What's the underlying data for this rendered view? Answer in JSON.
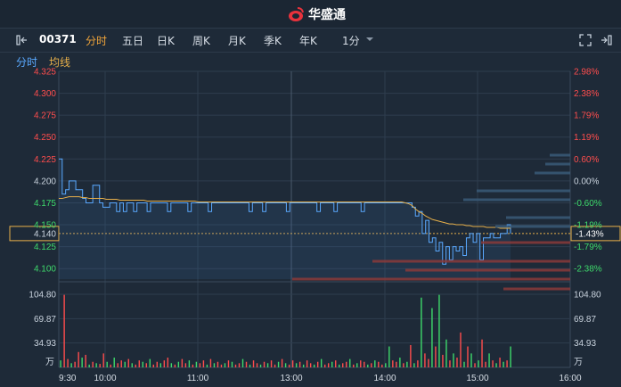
{
  "app": {
    "brand_name": "华盛通"
  },
  "toolbar": {
    "stock_code": "00371",
    "tabs": [
      {
        "label": "分时",
        "active": true
      },
      {
        "label": "五日",
        "active": false
      },
      {
        "label": "日K",
        "active": false
      },
      {
        "label": "周K",
        "active": false
      },
      {
        "label": "月K",
        "active": false
      },
      {
        "label": "季K",
        "active": false
      },
      {
        "label": "年K",
        "active": false
      }
    ],
    "interval": "1分",
    "icons": [
      "expand-left-icon",
      "dropdown-icon",
      "fullscreen-icon",
      "collapse-right-icon"
    ]
  },
  "legend": {
    "series_price": "分时",
    "series_avg": "均线"
  },
  "colors": {
    "price_line": "#5aa9ff",
    "avg_line": "#e8b04a",
    "up": "#ff4d4d",
    "down": "#3ed96b",
    "grid": "#2e3d4e",
    "current": "#e8b04a"
  },
  "chart_data": [
    {
      "type": "line",
      "y_left_ticks": [
        "4.325",
        "4.300",
        "4.275",
        "4.250",
        "4.225",
        "4.200",
        "4.175",
        "4.150",
        "4.125",
        "4.100"
      ],
      "y_right_ticks": [
        "2.98%",
        "2.38%",
        "1.79%",
        "1.19%",
        "0.60%",
        "0.00%",
        "-0.60%",
        "-1.19%",
        "-1.79%",
        "-2.38%"
      ],
      "ylim": [
        4.088,
        4.325
      ],
      "prev_close": 4.2,
      "current_price": "4.140",
      "current_change": "-1.43%",
      "x_ticks": [
        "9:30",
        "10:00",
        "11:00",
        "13:00",
        "14:00",
        "15:00",
        "16:00"
      ],
      "series": [
        {
          "name": "分时",
          "values": [
            4.225,
            4.185,
            4.19,
            4.2,
            4.2,
            4.19,
            4.19,
            4.18,
            4.175,
            4.175,
            4.195,
            4.195,
            4.175,
            4.17,
            4.17,
            4.175,
            4.175,
            4.165,
            4.175,
            4.165,
            4.175,
            4.175,
            4.165,
            4.175,
            4.175,
            4.175,
            4.165,
            4.175,
            4.175,
            4.175,
            4.175,
            4.175,
            4.165,
            4.175,
            4.175,
            4.175,
            4.175,
            4.175,
            4.165,
            4.175,
            4.175,
            4.175,
            4.175,
            4.175,
            4.165,
            4.175,
            4.175,
            4.175,
            4.175,
            4.175,
            4.175,
            4.175,
            4.175,
            4.175,
            4.175,
            4.175,
            4.165,
            4.175,
            4.175,
            4.175,
            4.165,
            4.175,
            4.175,
            4.175,
            4.175,
            4.175,
            4.175,
            4.165,
            4.175,
            4.175,
            4.175,
            4.175,
            4.175,
            4.175,
            4.175,
            4.175,
            4.165,
            4.175,
            4.175,
            4.175,
            4.175,
            4.165,
            4.175,
            4.175,
            4.175,
            4.175,
            4.175,
            4.175,
            4.175,
            4.165,
            4.175,
            4.175,
            4.175,
            4.175,
            4.175,
            4.175,
            4.175,
            4.175,
            4.175,
            4.175,
            4.175,
            4.175,
            4.175,
            4.175,
            4.17,
            4.16,
            4.165,
            4.14,
            4.155,
            4.13,
            4.135,
            4.12,
            4.13,
            4.105,
            4.125,
            4.11,
            4.125,
            4.12,
            4.125,
            4.115,
            4.135,
            4.14,
            4.13,
            4.14,
            4.11,
            4.135,
            4.135,
            4.14,
            4.135,
            4.135,
            4.14,
            4.14,
            4.15,
            4.14
          ]
        },
        {
          "name": "均线",
          "values": [
            4.18,
            4.18,
            4.181,
            4.182,
            4.182,
            4.182,
            4.182,
            4.181,
            4.181,
            4.18,
            4.18,
            4.18,
            4.18,
            4.18,
            4.179,
            4.179,
            4.179,
            4.179,
            4.178,
            4.178,
            4.178,
            4.178,
            4.178,
            4.178,
            4.178,
            4.178,
            4.177,
            4.177,
            4.177,
            4.177,
            4.177,
            4.177,
            4.177,
            4.177,
            4.177,
            4.177,
            4.177,
            4.177,
            4.177,
            4.177,
            4.177,
            4.176,
            4.176,
            4.176,
            4.176,
            4.176,
            4.176,
            4.176,
            4.176,
            4.176,
            4.176,
            4.176,
            4.176,
            4.176,
            4.176,
            4.176,
            4.176,
            4.176,
            4.176,
            4.176,
            4.176,
            4.176,
            4.176,
            4.176,
            4.176,
            4.176,
            4.176,
            4.176,
            4.176,
            4.176,
            4.176,
            4.176,
            4.176,
            4.176,
            4.176,
            4.176,
            4.176,
            4.176,
            4.176,
            4.176,
            4.176,
            4.176,
            4.176,
            4.176,
            4.176,
            4.176,
            4.176,
            4.176,
            4.176,
            4.176,
            4.176,
            4.176,
            4.176,
            4.176,
            4.176,
            4.176,
            4.176,
            4.176,
            4.176,
            4.176,
            4.176,
            4.176,
            4.175,
            4.174,
            4.172,
            4.168,
            4.165,
            4.163,
            4.16,
            4.158,
            4.156,
            4.155,
            4.154,
            4.153,
            4.152,
            4.151,
            4.151,
            4.15,
            4.15,
            4.15,
            4.149,
            4.149,
            4.148,
            4.148,
            4.148,
            4.148,
            4.147,
            4.147,
            4.147,
            4.147,
            4.146,
            4.146,
            4.146,
            4.146
          ]
        }
      ]
    },
    {
      "type": "bar",
      "y_ticks": [
        "104.80",
        "69.87",
        "34.93"
      ],
      "unit": "万",
      "ylim": [
        0,
        104.8
      ],
      "values": [
        10,
        104,
        12,
        6,
        8,
        22,
        14,
        18,
        4,
        8,
        6,
        5,
        20,
        8,
        4,
        14,
        6,
        10,
        8,
        12,
        6,
        4,
        10,
        8,
        6,
        12,
        4,
        8,
        6,
        10,
        14,
        6,
        4,
        8,
        12,
        6,
        10,
        4,
        8,
        6,
        10,
        4,
        12,
        6,
        8,
        4,
        6,
        10,
        8,
        4,
        6,
        12,
        8,
        4,
        10,
        6,
        4,
        8,
        6,
        10,
        4,
        8,
        12,
        6,
        4,
        10,
        6,
        8,
        4,
        10,
        6,
        4,
        8,
        12,
        4,
        6,
        8,
        10,
        4,
        6,
        8,
        12,
        4,
        6,
        10,
        8,
        4,
        6,
        10,
        8,
        4,
        6,
        30,
        10,
        8,
        14,
        6,
        8,
        32,
        6,
        10,
        100,
        20,
        12,
        85,
        30,
        104,
        18,
        40,
        10,
        20,
        14,
        50,
        8,
        30,
        20,
        6,
        10,
        40,
        8,
        20,
        10,
        6,
        14,
        8,
        10,
        30
      ],
      "colors_up": [
        false,
        true,
        true,
        false,
        true,
        true,
        false,
        true,
        false,
        true,
        false,
        true,
        true,
        false,
        true,
        false,
        true,
        true,
        false,
        true,
        false,
        true,
        true,
        false,
        true,
        false,
        true,
        true,
        false,
        true,
        true,
        false,
        true,
        false,
        true,
        true,
        false,
        true,
        false,
        true,
        true,
        false,
        true,
        false,
        true,
        true,
        false,
        true,
        false,
        true,
        true,
        false,
        true,
        false,
        true,
        true,
        false,
        true,
        false,
        true,
        true,
        false,
        true,
        false,
        true,
        true,
        false,
        true,
        false,
        true,
        true,
        false,
        true,
        false,
        true,
        true,
        false,
        true,
        false,
        true,
        true,
        false,
        true,
        false,
        true,
        true,
        false,
        true,
        false,
        true,
        true,
        false,
        false,
        true,
        true,
        false,
        true,
        false,
        true,
        false,
        true,
        false,
        true,
        true,
        false,
        true,
        false,
        true,
        false,
        true,
        false,
        true,
        true,
        false,
        true,
        false,
        true,
        false,
        true,
        true,
        false,
        true,
        false,
        true,
        false,
        true,
        false
      ]
    }
  ]
}
